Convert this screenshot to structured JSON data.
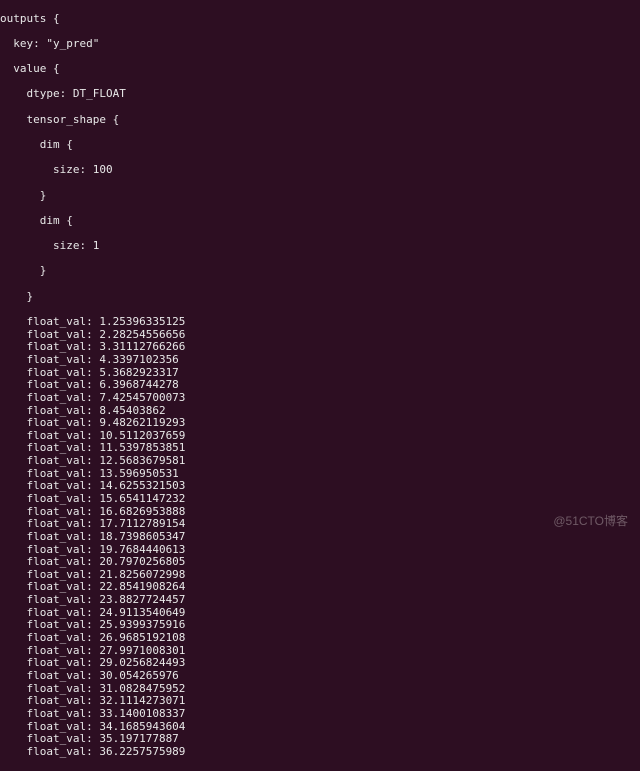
{
  "header": {
    "line1": "outputs {",
    "line2": "  key: \"y_pred\"",
    "line3": "  value {",
    "line4": "    dtype: DT_FLOAT",
    "line5": "    tensor_shape {",
    "line6": "      dim {",
    "line7": "        size: 100",
    "line8": "      }",
    "line9": "      dim {",
    "line10": "        size: 1",
    "line11": "      }",
    "line12": "    }"
  },
  "float_label": "float_val",
  "float_vals": [
    "1.25396335125",
    "2.28254556656",
    "3.31112766266",
    "4.3397102356",
    "5.3682923317",
    "6.3968744278",
    "7.42545700073",
    "8.45403862",
    "9.48262119293",
    "10.5112037659",
    "11.5397853851",
    "12.5683679581",
    "13.596950531",
    "14.6255321503",
    "15.6541147232",
    "16.6826953888",
    "17.7112789154",
    "18.7398605347",
    "19.7684440613",
    "20.7970256805",
    "21.8256072998",
    "22.8541908264",
    "23.8827724457",
    "24.9113540649",
    "25.9399375916",
    "26.9685192108",
    "27.9971008301",
    "29.0256824493",
    "30.054265976",
    "31.0828475952",
    "32.1114273071",
    "33.1400108337",
    "34.1685943604",
    "35.197177887",
    "36.2257575989"
  ],
  "watermark": "@51CTO博客"
}
